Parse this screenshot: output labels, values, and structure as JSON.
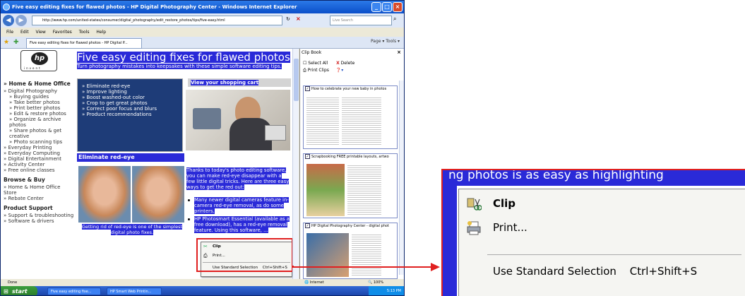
{
  "browser": {
    "title": "Five easy editing fixes for flawed photos - HP Digital Photography Center - Windows Internet Explorer",
    "url": "http://www.hp.com/united-states/consumer/digital_photography/edit_restore_photos/tips/five-easy.html",
    "search_placeholder": "Live Search",
    "menu": [
      "File",
      "Edit",
      "View",
      "Favorites",
      "Tools",
      "Help"
    ],
    "tab_label": "Five easy editing fixes for flawed photos - HP Digital P...",
    "tab_tools": "Page ▾  Tools ▾",
    "status_text": "Done",
    "status_zone": "Internet",
    "status_zoom": "100%"
  },
  "page": {
    "logo_text": "hp",
    "logo_tagline": "invent",
    "heading": "Five easy editing fixes for flawed photos",
    "subheading": "Turn photography mistakes into keepsakes with these simple software editing tips.",
    "shop_link": "View your shopping cart",
    "tips": [
      "» Eliminate red-eye",
      "» Improve lighting",
      "» Boost washed-out color",
      "» Crop to get great photos",
      "» Correct poor focus and blurs",
      "» Product recommendations"
    ],
    "section_title": "Eliminate red-eye",
    "caption": "Getting rid of red-eye is one of the simplest digital photo fixes.",
    "paragraph": "Thanks to today's photo editing software, you can make red-eye disappear with a few little digital tricks. Here are three easy ways to get the red out:",
    "bullets": [
      "Many newer digital cameras feature in-camera red-eye removal, as do some printers.",
      "HP Photosmart Essential (available as a free download), has a red-eye removal feature. Using this software, ..."
    ]
  },
  "nav": [
    {
      "label": "» Home & Home Office",
      "level": "h"
    },
    {
      "label": "» Digital Photography",
      "level": "i"
    },
    {
      "label": "» Buying guides",
      "level": "ii"
    },
    {
      "label": "» Take better photos",
      "level": "ii"
    },
    {
      "label": "» Print better photos",
      "level": "ii"
    },
    {
      "label": "» Edit & restore photos",
      "level": "ii"
    },
    {
      "label": "» Organize & archive photos",
      "level": "ii"
    },
    {
      "label": "» Share photos & get creative",
      "level": "ii"
    },
    {
      "label": "» Photo scanning tips",
      "level": "ii"
    },
    {
      "label": "» Everyday Printing",
      "level": "i"
    },
    {
      "label": "» Everyday Computing",
      "level": "i"
    },
    {
      "label": "» Digital Entertainment",
      "level": "i"
    },
    {
      "label": "» Activity Center",
      "level": "i"
    },
    {
      "label": "» Free online classes",
      "level": "i"
    },
    {
      "label": "Browse & Buy",
      "level": "h"
    },
    {
      "label": "» Home & Home Office Store",
      "level": "i"
    },
    {
      "label": "» Rebate Center",
      "level": "i"
    },
    {
      "label": "Product Support",
      "level": "h"
    },
    {
      "label": "» Support & troubleshooting",
      "level": "i"
    },
    {
      "label": "» Software & drivers",
      "level": "i"
    }
  ],
  "clipbook": {
    "title": "Clip Book",
    "select_all": "Select All",
    "delete": "Delete",
    "print_clips": "Print Clips",
    "clips": [
      "How to celebrate your new baby in photos",
      "Scrapbooking FREE printable layouts, artwo",
      "HP Digital Photography Center - digital phot"
    ]
  },
  "context_menu": {
    "clip": "Clip",
    "print": "Print...",
    "standard": "Use Standard Selection",
    "shortcut": "Ctrl+Shift+S"
  },
  "zoom": {
    "background_text": "ng photos is as easy as highlighting"
  },
  "taskbar": {
    "start": "start",
    "tasks": [
      "Five easy editing fixe...",
      "HP Smart Web Printin..."
    ],
    "clock": "5:13 PM"
  },
  "colors": {
    "selection": "#2a2ad8",
    "callout": "#e02020",
    "nav_blue": "#1e3c78"
  }
}
